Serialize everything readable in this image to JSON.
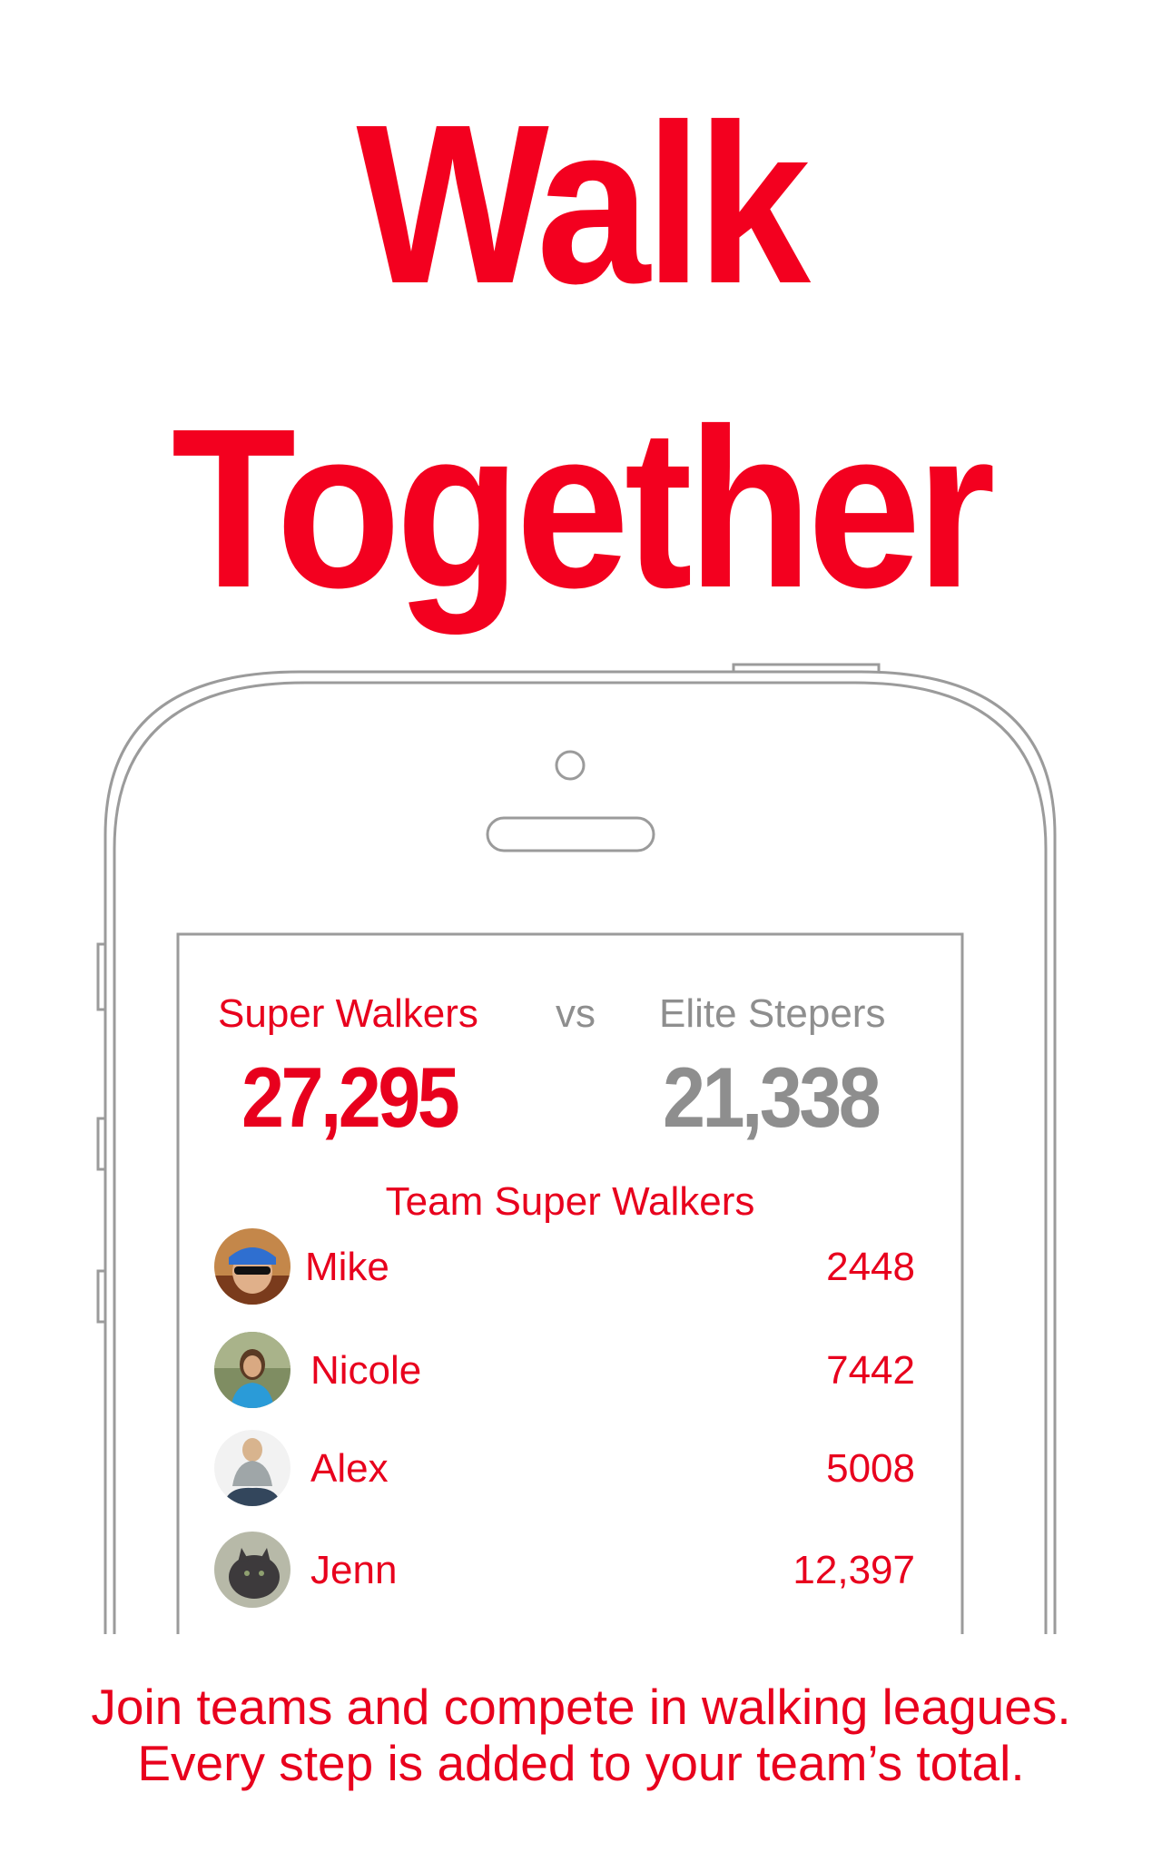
{
  "headline": {
    "line1": "Walk",
    "line2": "Together"
  },
  "matchup": {
    "team_a": {
      "name": "Super Walkers",
      "score": "27,295"
    },
    "vs_label": "vs",
    "team_b": {
      "name": "Elite Stepers",
      "score": "21,338"
    }
  },
  "roster": {
    "title": "Team Super Walkers",
    "members": [
      {
        "name": "Mike",
        "steps": "2448"
      },
      {
        "name": "Nicole",
        "steps": "7442"
      },
      {
        "name": "Alex",
        "steps": "5008"
      },
      {
        "name": "Jenn",
        "steps": "12,397"
      }
    ]
  },
  "tagline": {
    "line1": "Join teams and compete in walking leagues.",
    "line2": "Every step is added to your team’s total."
  },
  "colors": {
    "accent": "#e8001d",
    "muted": "#8e8e8e",
    "outline": "#9b9b9b"
  }
}
